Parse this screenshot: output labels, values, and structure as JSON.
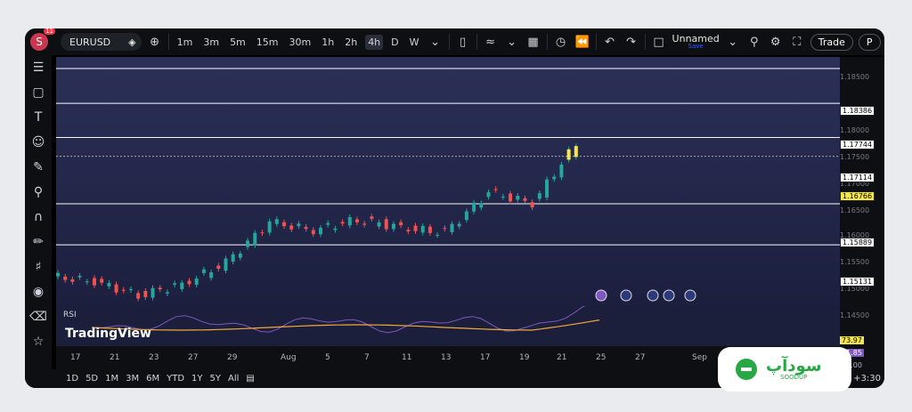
{
  "topbar": {
    "avatar_letter": "S",
    "notification_count": "11",
    "symbol": "EURUSD",
    "timeframes": [
      "1m",
      "3m",
      "5m",
      "15m",
      "30m",
      "1h",
      "2h",
      "4h",
      "D",
      "W"
    ],
    "active_timeframe": "4h",
    "layout_name": "Unnamed",
    "save_label": "Save",
    "trade_label": "Trade",
    "publish_label": "P"
  },
  "bottombar": {
    "ranges": [
      "1D",
      "5D",
      "1M",
      "3M",
      "6M",
      "YTD",
      "1Y",
      "5Y",
      "All"
    ],
    "timezone": "+3:30"
  },
  "price_axis": {
    "ticks": [
      "1.18500",
      "1.18000",
      "1.17500",
      "1.17000",
      "1.16500",
      "1.16000",
      "1.15500",
      "1.15000",
      "1.14500"
    ],
    "levels": [
      "1.18386",
      "1.17744",
      "1.17114",
      "1.15889",
      "1.15131"
    ],
    "current_price": "1.16766"
  },
  "time_axis": {
    "labels": [
      "17",
      "21",
      "23",
      "27",
      "29",
      "Aug",
      "5",
      "7",
      "11",
      "13",
      "17",
      "19",
      "21",
      "25",
      "27",
      "Sep"
    ]
  },
  "rsi": {
    "label": "RSI",
    "value1": "73.97",
    "value2": "61.85",
    "level": "40.00"
  },
  "branding": {
    "tradingview": "TradingView",
    "watermark": "سودآپ",
    "watermark_sub": "SOODUP"
  },
  "colors": {
    "candle_up": "#26a69a",
    "candle_down": "#ef5350",
    "highlight_candle": "#f7e64a",
    "level_line": "#ffffff",
    "rsi_line": "#7e57c2",
    "rsi_ma": "#f2a93b",
    "accent": "#2962ff"
  },
  "chart_data": {
    "type": "line",
    "x": [
      "17",
      "21",
      "23",
      "27",
      "29",
      "Aug",
      "5",
      "7",
      "11",
      "13",
      "17",
      "19",
      "21"
    ],
    "values": [
      1.1455,
      1.1445,
      1.142,
      1.144,
      1.148,
      1.1555,
      1.154,
      1.156,
      1.1545,
      1.1535,
      1.161,
      1.159,
      1.17
    ],
    "ylim": [
      1.14,
      1.186
    ]
  }
}
